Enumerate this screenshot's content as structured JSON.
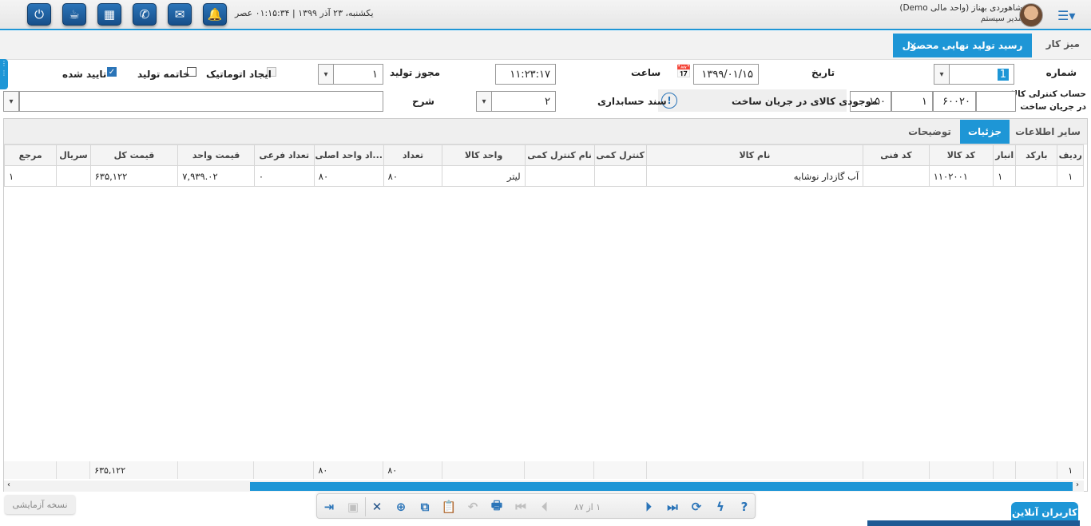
{
  "topbar": {
    "datetime": "یکشنبه، ۲۳ آذر ۱۳۹۹ | ۰۱:۱۵:۳۴ عصر",
    "user_name": "شاهوردی بهناز (واحد مالی Demo)",
    "user_role": "مدیر سیستم",
    "icons": [
      "power-icon",
      "tea-icon",
      "calculator-icon",
      "phone-icon",
      "mail-icon",
      "bell-icon"
    ]
  },
  "tabs": {
    "desk": "میز کار",
    "active": "رسید تولید نهایی محصول",
    "close": "×"
  },
  "form": {
    "number_label": "شماره",
    "number_value": "1",
    "date_label": "تاریخ",
    "date_value": "۱۳۹۹/۰۱/۱۵",
    "time_label": "ساعت",
    "time_value": "۱۱:۲۳:۱۷",
    "permit_label": "مجوز تولید",
    "permit_value": "۱",
    "auto_create_label": "ایجاد اتوماتیک",
    "production_end_label": "خاتمه تولید",
    "approved_label": "تایید شده",
    "control_account_label_1": "حساب کنترلی کالای",
    "control_account_label_2": "در جریان ساخت",
    "control_account_code": "۶۰۰۲۰",
    "control_account_part2": "۱",
    "control_account_part3": "۱۵۰",
    "wip_label": "موجودی کالای در جریان ساخت",
    "accounting_doc_label": "سند حسابداری",
    "accounting_doc_value": "۲",
    "description_label": "شرح",
    "description_value": ""
  },
  "subtabs": {
    "other": "سایر اطلاعات",
    "details": "جزئیات",
    "notes": "توضیحات"
  },
  "grid": {
    "headers": [
      "ردیف",
      "بارکد",
      "انبار",
      "کد کالا",
      "کد فنی",
      "نام کالا",
      "کنترل کمی",
      "نام کنترل کمی",
      "واحد کالا",
      "تعداد",
      "...اد واحد اصلی",
      "تعداد فرعی",
      "قیمت واحد",
      "قیمت کل",
      "سریال",
      "مرجع"
    ],
    "rows": [
      [
        "۱",
        "",
        "۱",
        "۱۱۰۲۰۰۱",
        "",
        "آب گازدار نوشابه",
        "",
        "",
        "لیتر",
        "۸۰",
        "۸۰",
        "۰",
        "۷,۹۳۹.۰۲",
        "۶۳۵,۱۲۲",
        "",
        "۱"
      ]
    ],
    "footer": [
      "۱",
      "",
      "",
      "",
      "",
      "",
      "",
      "",
      "",
      "۸۰",
      "۸۰",
      "",
      "",
      "۶۳۵,۱۲۲",
      "",
      ""
    ]
  },
  "toolbar": {
    "pager": "۱ از ۸۷"
  },
  "bottom": {
    "trial": "نسخه آزمایشی",
    "online_users": "کاربران آنلاین"
  },
  "colors": {
    "accent": "#1e96d6",
    "icon_blue": "#2a74b8"
  }
}
